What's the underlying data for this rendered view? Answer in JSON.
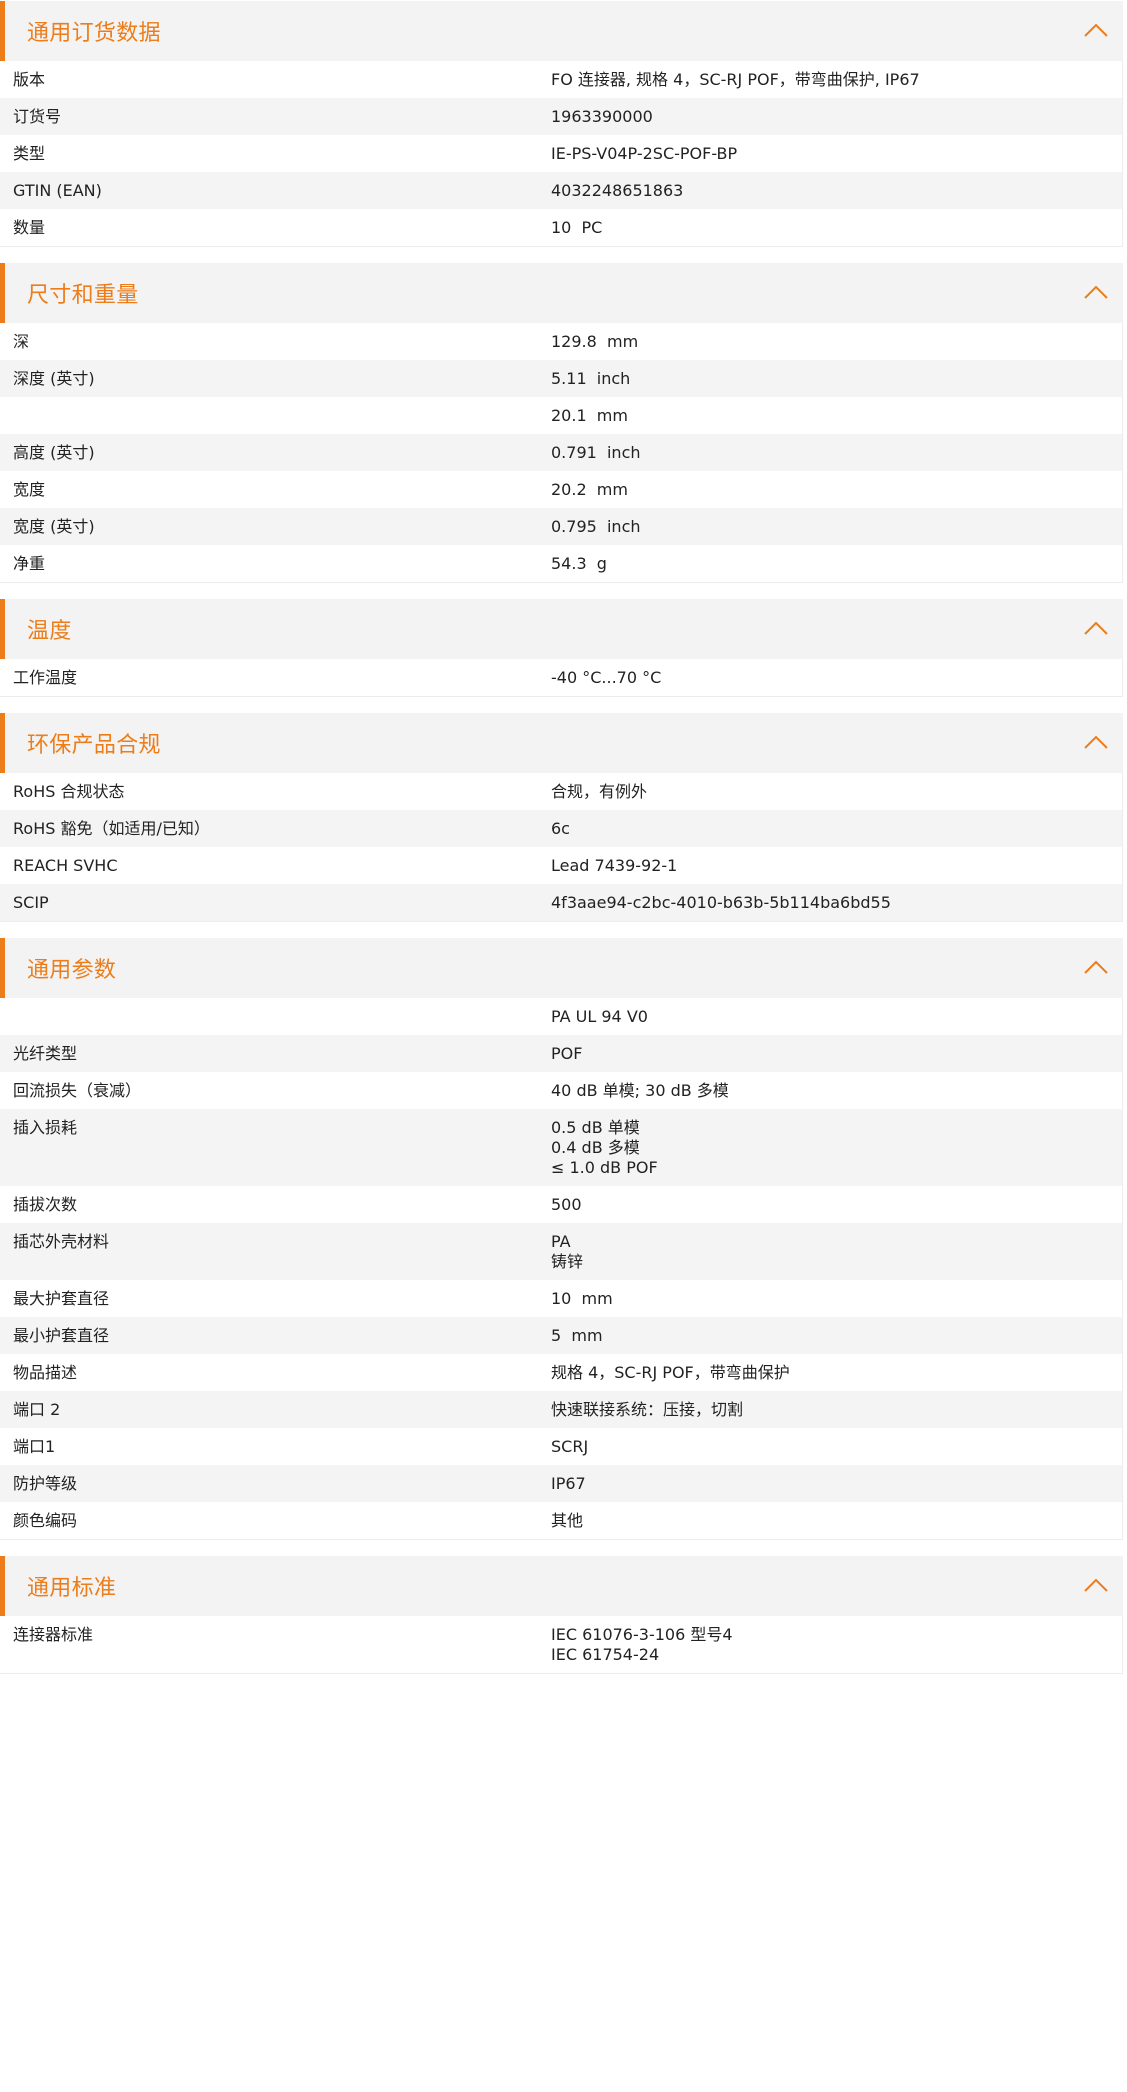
{
  "accent_color": "#ed7d1a",
  "icons": {
    "collapse": "chevron-up-icon"
  },
  "sections": [
    {
      "title": "通用订货数据",
      "rows": [
        {
          "label": "版本",
          "value": "FO 连接器, 规格 4，SC-RJ POF，带弯曲保护, IP67"
        },
        {
          "label": "订货号",
          "value": "1963390000"
        },
        {
          "label": "类型",
          "value": "IE-PS-V04P-2SC-POF-BP"
        },
        {
          "label": "GTIN (EAN)",
          "value": "4032248651863"
        },
        {
          "label": "数量",
          "value": "10  PC"
        }
      ]
    },
    {
      "title": "尺寸和重量",
      "rows": [
        {
          "label": "深",
          "value": "129.8  mm"
        },
        {
          "label": "深度 (英寸)",
          "value": "5.11  inch"
        },
        {
          "label": "",
          "value": "20.1  mm"
        },
        {
          "label": "高度 (英寸)",
          "value": "0.791  inch"
        },
        {
          "label": "宽度",
          "value": "20.2  mm"
        },
        {
          "label": "宽度 (英寸)",
          "value": "0.795  inch"
        },
        {
          "label": "净重",
          "value": "54.3  g"
        }
      ]
    },
    {
      "title": "温度",
      "rows": [
        {
          "label": "工作温度",
          "value": "-40 °C...70 °C"
        }
      ]
    },
    {
      "title": "环保产品合规",
      "rows": [
        {
          "label": "RoHS 合规状态",
          "value": "合规，有例外"
        },
        {
          "label": "RoHS 豁免（如适用/已知）",
          "value": "6c"
        },
        {
          "label": "REACH SVHC",
          "value": "Lead 7439-92-1"
        },
        {
          "label": "SCIP",
          "value": "4f3aae94-c2bc-4010-b63b-5b114ba6bd55"
        }
      ]
    },
    {
      "title": "通用参数",
      "rows": [
        {
          "label": "",
          "value": "PA UL 94 V0"
        },
        {
          "label": "光纤类型",
          "value": "POF"
        },
        {
          "label": "回流损失（衰减）",
          "value": "40 dB 单模; 30 dB 多模"
        },
        {
          "label": "插入损耗",
          "value": "0.5 dB 单模\n0.4 dB 多模\n≤ 1.0 dB POF"
        },
        {
          "label": "插拔次数",
          "value": "500"
        },
        {
          "label": "插芯外壳材料",
          "value": "PA\n铸锌"
        },
        {
          "label": "最大护套直径",
          "value": "10  mm"
        },
        {
          "label": "最小护套直径",
          "value": "5  mm"
        },
        {
          "label": "物品描述",
          "value": "规格 4，SC-RJ POF，带弯曲保护"
        },
        {
          "label": "端口 2",
          "value": "快速联接系统：压接，切割"
        },
        {
          "label": "端口1",
          "value": "SCRJ"
        },
        {
          "label": "防护等级",
          "value": "IP67"
        },
        {
          "label": "颜色编码",
          "value": "其他"
        }
      ]
    },
    {
      "title": "通用标准",
      "rows": [
        {
          "label": "连接器标准",
          "value": "IEC 61076-3-106 型号4\nIEC 61754-24"
        }
      ]
    }
  ]
}
